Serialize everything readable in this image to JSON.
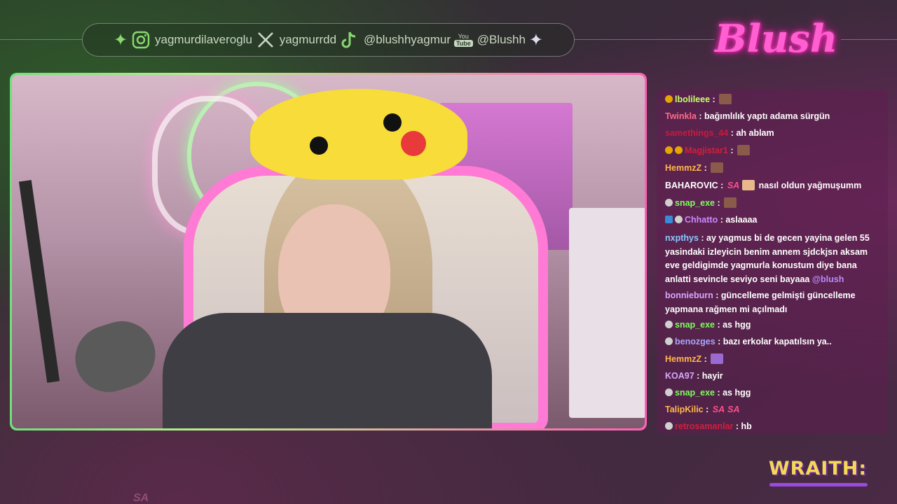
{
  "social": {
    "instagram": "yagmurdilaveroglu",
    "x": "yagmurrdd",
    "tiktok": "@blushhyagmur",
    "youtube_badge_top": "You",
    "youtube_badge_bottom": "Tube",
    "youtube": "@Blushh"
  },
  "logo": {
    "text": "Blush"
  },
  "chat": {
    "messages": [
      {
        "user": "lbolileee",
        "color": "#c8ff6a",
        "sep": " : ",
        "text": ""
      },
      {
        "user": "Twinkla",
        "color": "#ff6a8a",
        "sep": " : ",
        "text": "bağımlılık yaptı adama sürgün"
      },
      {
        "user": "samethings_44",
        "color": "#c81a3a",
        "sep": " : ",
        "text": "ah ablam"
      },
      {
        "user": "Magjistar1",
        "color": "#d0203a",
        "sep": " : ",
        "text": ""
      },
      {
        "user": "HemmzZ",
        "color": "#ffb84a",
        "sep": " : ",
        "text": ""
      },
      {
        "user": "BAHAROVIC",
        "color": "#ffffff",
        "sep": " : ",
        "text": "nasıl oldun yağmuşumm",
        "sa": "SA"
      },
      {
        "user": "snap_exe",
        "color": "#7cff5a",
        "sep": " : ",
        "text": ""
      },
      {
        "user": "Chhatto",
        "color": "#c88aff",
        "sep": " : ",
        "text": "aslaaaa"
      },
      {
        "user": "nxpthys",
        "color": "#8ac8ff",
        "sep": " : ",
        "text": "ay yagmus bi de gecen yayina gelen 55 yasindaki izleyicin benim annem sjdckjsn aksam eve geldigimde yagmurla konustum diye bana anlatti sevincle seviyo seni bayaaa",
        "mention": "@blush"
      },
      {
        "user": "bonnieburn",
        "color": "#d8a8ff",
        "sep": " : ",
        "text": "güncelleme gelmişti güncelleme yapmana rağmen mi açılmadı"
      },
      {
        "user": "snap_exe",
        "color": "#7cff5a",
        "sep": " : ",
        "text": "as hgg"
      },
      {
        "user": "benozges",
        "color": "#a8a8ff",
        "sep": " : ",
        "text": "bazı erkolar kapatılsın ya.."
      },
      {
        "user": "HemmzZ",
        "color": "#ffb84a",
        "sep": " : ",
        "text": ""
      },
      {
        "user": "KOA97",
        "color": "#d8a8ff",
        "sep": " : ",
        "text": "hayir"
      },
      {
        "user": "snap_exe",
        "color": "#7cff5a",
        "sep": " : ",
        "text": "as hgg"
      },
      {
        "user": "TalipKilic",
        "color": "#ffb84a",
        "sep": " : ",
        "text": "",
        "sa": "SA",
        "sa2": "SA"
      },
      {
        "user": "retrosamanlar",
        "color": "#d0203a",
        "sep": " : ",
        "text": "hb"
      }
    ]
  },
  "sponsor": {
    "text": "WRAITH:"
  },
  "watermark": {
    "text": "SA"
  },
  "colors": {
    "accent_pink": "#ff5fb5",
    "accent_green": "#6fe07a",
    "logo_pink": "#ff5fd0",
    "sponsor_gold": "#f5d75a"
  }
}
